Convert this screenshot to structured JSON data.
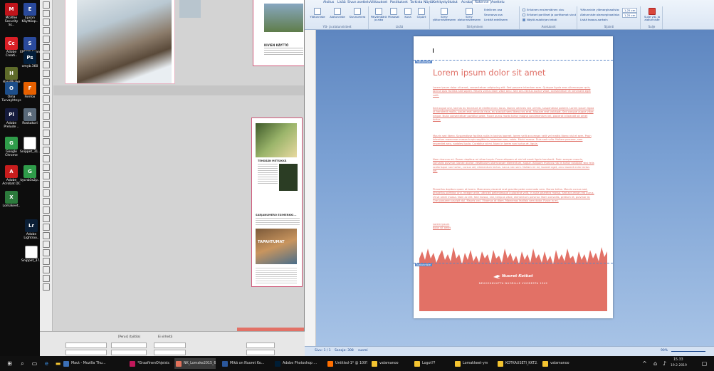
{
  "desktop": {
    "icons": [
      {
        "label": "McAfee Security Sc..",
        "color": "#c0141b",
        "glyph": "M"
      },
      {
        "label": "Epson Käyttöop..",
        "color": "#2a4a9c",
        "glyph": "E"
      },
      {
        "label": "Adobe Creati..",
        "color": "#da1f26",
        "glyph": "Cc"
      },
      {
        "label": "EPSON Scan",
        "color": "#2a4a9c",
        "glyph": "S"
      },
      {
        "label": "HandBrake",
        "color": "#5e6b2a",
        "glyph": "H"
      },
      {
        "label": "omyb.360",
        "color": "#031e3a",
        "glyph": "Ps"
      },
      {
        "label": "Oma Turvayhteys",
        "color": "#1d4e8a",
        "glyph": "O"
      },
      {
        "label": "Firefox",
        "color": "#e66000",
        "glyph": "F"
      },
      {
        "label": "Adobe Prelude ..",
        "color": "#151b3d",
        "glyph": "Pl"
      },
      {
        "label": "Roskakori",
        "color": "#5a6a7a",
        "glyph": "R"
      },
      {
        "label": "Google Chrome",
        "color": "#2f9c4a",
        "glyph": "G"
      },
      {
        "label": "Snippet_31..",
        "color": "#ffffff",
        "glyph": ""
      },
      {
        "label": "Adobe Acrobat DC",
        "color": "#c81d1d",
        "glyph": "A"
      },
      {
        "label": "kycnb3s2p..",
        "color": "#2f9c4a",
        "glyph": "G"
      },
      {
        "label": "Lomakeet..",
        "color": "#2c7a3c",
        "glyph": "X"
      },
      {
        "label": "Adobe Lightroo..",
        "color": "#0b1f36",
        "glyph": "Lr"
      },
      {
        "label": "Snippet_37..",
        "color": "#ffffff",
        "glyph": ""
      }
    ]
  },
  "indesign": {
    "page1_heading": "KIVIEN KÄYTTÖ",
    "page2_heading": "TEHDÄÄN METSIKKÄ",
    "page2_subheading": "SARJANUMERO ESIMERKKI...",
    "page2_banner": "TAPAHTUMAT",
    "zoom": "[Perus] (työtila)",
    "status": "Ei virheitä"
  },
  "word": {
    "tabs": [
      "Aloitus",
      "Lisää",
      "Sivun asettelu",
      "Viittaukset",
      "Postitukset",
      "Tarkista",
      "Näytä",
      "Kehitystyökalut",
      "Acrobat",
      "Rakenne",
      "Asettelu"
    ],
    "active_tab": "Rakenne",
    "groups": {
      "headers": {
        "label": "Ylä- ja alatunnisteet",
        "buttons": [
          "Ylätunniste",
          "Alatunniste",
          "Sivunumero"
        ]
      },
      "insert": {
        "label": "Lisää",
        "buttons": [
          "Päivämäärä ja aika",
          "Pikaosat",
          "Kuva",
          "ClipArt"
        ]
      },
      "nav": {
        "label": "Siirtyminen",
        "buttons": [
          "Siirry ylätunnisteeseen",
          "Siirry alatunnisteeseen"
        ],
        "links": [
          "Edellinen osa",
          "Seuraava osa",
          "Linkitä edelliseen"
        ]
      },
      "options": {
        "label": "Asetukset",
        "checks": [
          "Erilainen ensimmäinen sivu",
          "Erilaiset parilliset ja parittomat sivut",
          "Näytä asiakirjan teksti"
        ]
      },
      "position": {
        "label": "Sijainti",
        "rows": [
          "Ylätunniste ylämarginaalista:",
          "Alatunniste alamarginaalista:",
          "Lisää tasaus-sarkain"
        ],
        "values": [
          "1,25 cm",
          "1,25 cm"
        ]
      },
      "close": {
        "label": "Sulje",
        "button": "Sulje ylä- ja alatunniste"
      }
    },
    "document": {
      "header_tag": "Ylätunniste",
      "footer_tag": "Alatunniste",
      "title": "Lorem ipsum dolor sit amet",
      "paragraphs": [
        "Lorem ipsum dolor sit amet, consectetuer adipiscing elit. Sed posuere interdum sem. Quisque ligula eros ullamcorper quis, lacinia quis facilisis sed sapien. Mauris varius diam vitae arcu. Sed arcu lectus auctor vitae, consectetuer et venenatis eget velit.",
        "Sed augue orci, lacinia eu tincidunt et eleifend nec lacus. Donec ultricies nisl ut felis, suspendisse potenti. Lorem ipsum ligula ut hendrerit mollis, ipsum erat vehicula risus, eu suscipit sem libero nec erat. Aliquam erat volutpat. Sed congue augue vitae neque. Nulla consectetuer porttitor pede. Fusce purus morbi tortor magna condimentum vel, placerat id blandit sit amet tortor.",
        "Mauris sed libero. Suspendisse facilisis nulla in lacinia laoreet, lorem velit accumsan velit vel mattis libero nisl et sem. Proin interdum maecenas massa turpis sagittis in, interdum non, nobis. Morbi massa. Duis sed nulla. Nullam posuere, sem imperdiet arcu, sodales ligula. Curabitur at mi. Nunc in lorem non luctus et, ligula.",
        "Nam rhoncus mi. Donec dapibus mi vitae turpis. Fusce aliquam et nisl sit amet ligula hendrerit. Proin semper mauris, convallis pulvinar. Donec auctor, vestibulum ullamcorper elementum, augue. Aliquam rhoncus nisi in tortor volutpat. Nisl felis scelerisque non tortor, cursus vel, elementum lectus. Lacus nec sem. Nullam mi mi, laoreet eget, arcu laoreet enim lectus vel.",
        "Phasellus dapibus quam et lorem. Maecenas placerat erat gravida pede commodo sem. Donec tellus. Mauris cursus sed, phasellus porttitor orci. Integer ante, ultricies pellentesque a placerat velit, in nulla pharetra massa. Sed accumsan est purus. Ut sit amet massa. Nam ac elit. Sed massa, nisl, tempus vitae, elementum pulvinar. Nam convallis, pretium et, pulvinar id. Cras posuere suscipit dui. Mauris orci. Vivamus at diam. Maecenas facilisis sem dolor. Fusce in mi.",
        "Lorem ipsum\ndolor sit amet"
      ],
      "footer_brand": "Nuoret Kotkat",
      "footer_tagline": "NEUVOKKUUTTA NUORILLE VUODESTA 1942"
    },
    "status": {
      "page": "Sivu: 1 / 1",
      "words": "Sanoja: 308",
      "lang": "suomi",
      "zoom": "90%"
    }
  },
  "taskbar": {
    "search_placeholder": "",
    "windows": [
      {
        "label": "Maut - Mozilla Thu...",
        "color": "#3b6fb6"
      },
      {
        "label": "*GraafinenOhjeisto...",
        "color": "#c2185b"
      },
      {
        "label": "NK_Lomake2015_6...",
        "color": "#e2725b"
      },
      {
        "label": "Mikä on Nuoret Ko...",
        "color": "#2b579a"
      },
      {
        "label": "Adobe Photoshop ...",
        "color": "#001e36"
      },
      {
        "label": "Untitled-1* @ 100%...",
        "color": "#ff6f00"
      },
      {
        "label": "valamanoo",
        "color": "#f4c430"
      },
      {
        "label": "Logot?? ",
        "color": "#f4c430"
      },
      {
        "label": "Lomakkeet-ym",
        "color": "#f4c430"
      },
      {
        "label": "KOTKAUSETI_KKT2...",
        "color": "#f4c430"
      },
      {
        "label": "valamanoo",
        "color": "#f4c430"
      }
    ],
    "time": "15.33",
    "date": "19.2.2019"
  }
}
